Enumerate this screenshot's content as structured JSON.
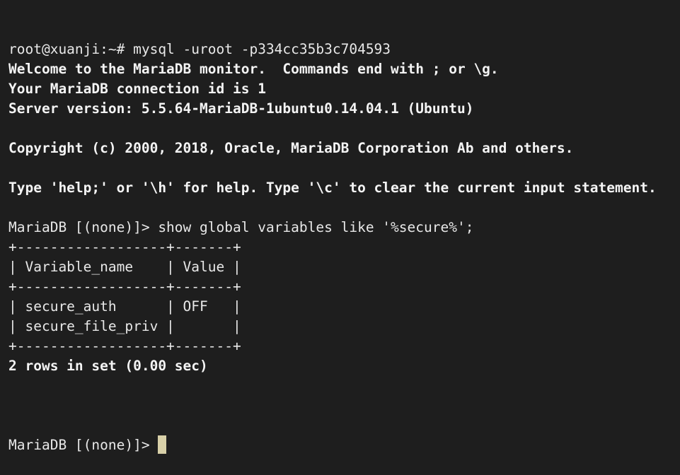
{
  "terminal": {
    "lines": [
      {
        "text": "root@xuanji:~# mysql -uroot -p334cc35b3c704593",
        "bold": false
      },
      {
        "text": "Welcome to the MariaDB monitor.  Commands end with ; or \\g.",
        "bold": true
      },
      {
        "text": "Your MariaDB connection id is 1",
        "bold": true
      },
      {
        "text": "Server version: 5.5.64-MariaDB-1ubuntu0.14.04.1 (Ubuntu)",
        "bold": true
      },
      {
        "text": "",
        "bold": false
      },
      {
        "text": "Copyright (c) 2000, 2018, Oracle, MariaDB Corporation Ab and others.",
        "bold": true
      },
      {
        "text": "",
        "bold": false
      },
      {
        "text": "Type 'help;' or '\\h' for help. Type '\\c' to clear the current input statement.",
        "bold": true
      },
      {
        "text": "",
        "bold": false
      },
      {
        "text": "MariaDB [(none)]> show global variables like '%secure%';",
        "bold": false
      },
      {
        "text": "+------------------+-------+",
        "bold": false
      },
      {
        "text": "| Variable_name    | Value |",
        "bold": false
      },
      {
        "text": "+------------------+-------+",
        "bold": false
      },
      {
        "text": "| secure_auth      | OFF   |",
        "bold": false
      },
      {
        "text": "| secure_file_priv |       |",
        "bold": false
      },
      {
        "text": "+------------------+-------+",
        "bold": false
      },
      {
        "text": "2 rows in set (0.00 sec)",
        "bold": true
      },
      {
        "text": "",
        "bold": false
      }
    ],
    "prompt": "MariaDB [(none)]> ",
    "colors": {
      "background": "#1e1e1e",
      "foreground": "#e8e8e8",
      "cursor": "#d8d0a8"
    }
  }
}
